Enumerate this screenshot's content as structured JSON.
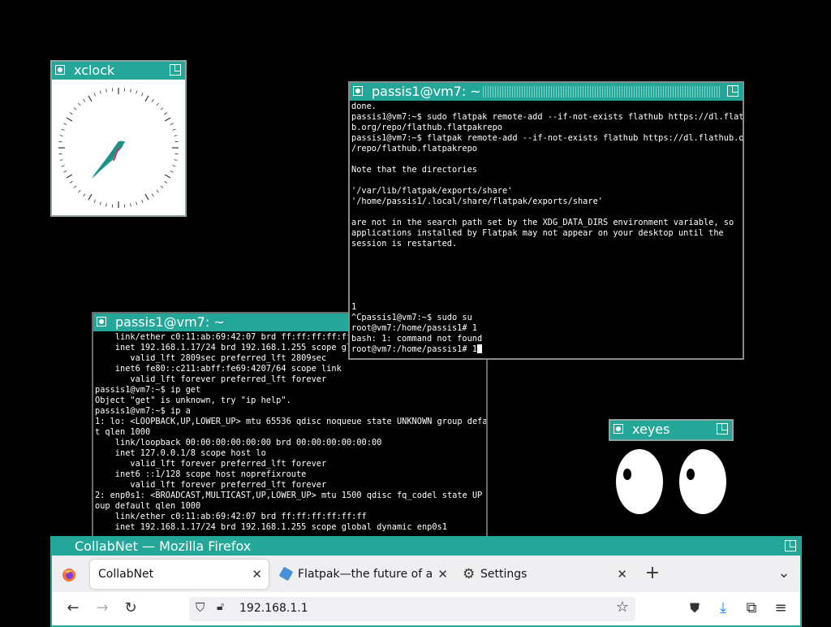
{
  "desktop": {
    "background": "#000000"
  },
  "xclock": {
    "title": "xclock"
  },
  "term1": {
    "title": "passis1@vm7: ~",
    "lines": [
      "done.",
      "passis1@vm7:~$ sudo flatpak remote-add --if-not-exists flathub https://dl.flathu",
      "b.org/repo/flathub.flatpakrepo",
      "passis1@vm7:~$ flatpak remote-add --if-not-exists flathub https://dl.flathub.org",
      "/repo/flathub.flatpakrepo",
      "",
      "Note that the directories",
      "",
      "'/var/lib/flatpak/exports/share'",
      "'/home/passis1/.local/share/flatpak/exports/share'",
      "",
      "are not in the search path set by the XDG_DATA_DIRS environment variable, so",
      "applications installed by Flatpak may not appear on your desktop until the",
      "session is restarted.",
      "",
      "",
      "",
      "",
      "",
      "1",
      "^Cpassis1@vm7:~$ sudo su",
      "root@vm7:/home/passis1# 1",
      "bash: 1: command not found"
    ],
    "prompt": "root@vm7:/home/passis1# 1"
  },
  "term2": {
    "title": "passis1@vm7: ~",
    "lines": [
      "    link/ether c0:11:ab:69:42:07 brd ff:ff:ff:ff:ff:ff",
      "    inet 192.168.1.17/24 brd 192.168.1.255 scope global dynamic enp0s1",
      "       valid_lft 2809sec preferred_lft 2809sec",
      "    inet6 fe80::c211:abff:fe69:4207/64 scope link",
      "       valid_lft forever preferred_lft forever",
      "passis1@vm7:~$ ip get",
      "Object \"get\" is unknown, try \"ip help\".",
      "passis1@vm7:~$ ip a",
      "1: lo: <LOOPBACK,UP,LOWER_UP> mtu 65536 qdisc noqueue state UNKNOWN group defaul",
      "t qlen 1000",
      "    link/loopback 00:00:00:00:00:00 brd 00:00:00:00:00:00",
      "    inet 127.0.0.1/8 scope host lo",
      "       valid_lft forever preferred_lft forever",
      "    inet6 ::1/128 scope host noprefixroute",
      "       valid_lft forever preferred_lft forever",
      "2: enp0s1: <BROADCAST,MULTICAST,UP,LOWER_UP> mtu 1500 qdisc fq_codel state UP gr",
      "oup default qlen 1000",
      "    link/ether c0:11:ab:69:42:07 brd ff:ff:ff:ff:ff:ff",
      "    inet 192.168.1.17/24 brd 192.168.1.255 scope global dynamic enp0s1"
    ]
  },
  "xeyes": {
    "title": "xeyes"
  },
  "firefox": {
    "title": "CollabNet — Mozilla Firefox",
    "tabs": [
      {
        "label": "CollabNet",
        "icon": "page-icon"
      },
      {
        "label": "Flatpak—the future of ap",
        "icon": "flatpak-icon"
      },
      {
        "label": "Settings",
        "icon": "gear-icon"
      }
    ],
    "url": "192.168.1.1",
    "colors": {
      "tab_strip": "#efeff2",
      "download_accent": "#0a84ff"
    }
  }
}
